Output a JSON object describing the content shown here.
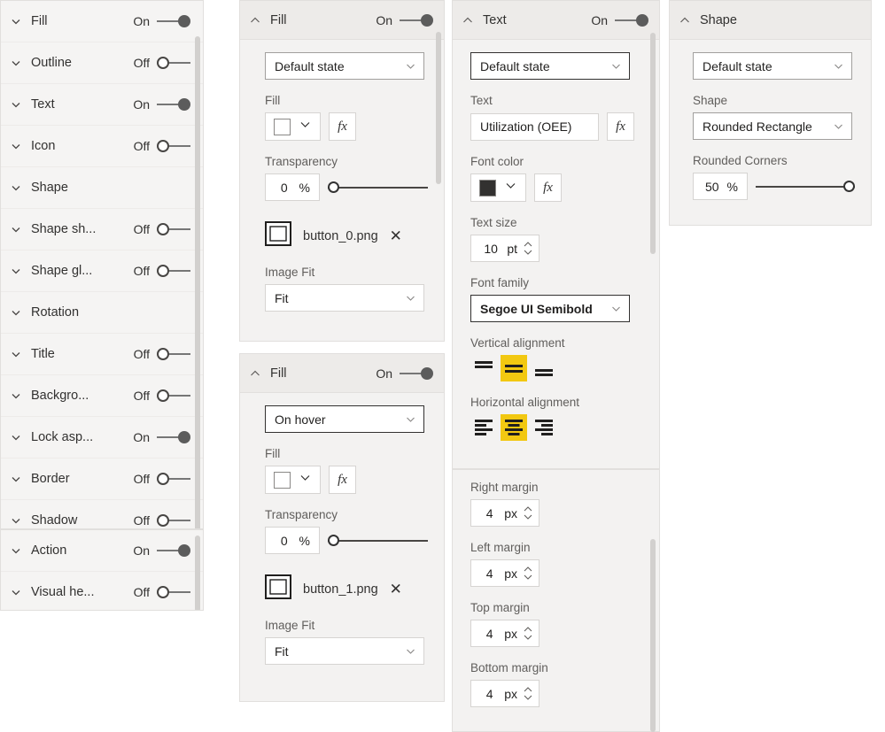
{
  "sidebar": {
    "top_items": [
      {
        "label": "Fill",
        "toggle_state": "On",
        "has_toggle": true
      },
      {
        "label": "Outline",
        "toggle_state": "Off",
        "has_toggle": true
      },
      {
        "label": "Text",
        "toggle_state": "On",
        "has_toggle": true
      },
      {
        "label": "Icon",
        "toggle_state": "Off",
        "has_toggle": true
      },
      {
        "label": "Shape",
        "toggle_state": "",
        "has_toggle": false
      },
      {
        "label": "Shape sh...",
        "toggle_state": "Off",
        "has_toggle": true
      },
      {
        "label": "Shape gl...",
        "toggle_state": "Off",
        "has_toggle": true
      },
      {
        "label": "Rotation",
        "toggle_state": "",
        "has_toggle": false
      },
      {
        "label": "Title",
        "toggle_state": "Off",
        "has_toggle": true
      },
      {
        "label": "Backgro...",
        "toggle_state": "Off",
        "has_toggle": true
      },
      {
        "label": "Lock asp...",
        "toggle_state": "On",
        "has_toggle": true
      },
      {
        "label": "Border",
        "toggle_state": "Off",
        "has_toggle": true
      },
      {
        "label": "Shadow",
        "toggle_state": "Off",
        "has_toggle": true
      }
    ],
    "bottom_items": [
      {
        "label": "Action",
        "toggle_state": "On",
        "has_toggle": true
      },
      {
        "label": "Visual he...",
        "toggle_state": "Off",
        "has_toggle": true
      }
    ]
  },
  "fill_default": {
    "header_title": "Fill",
    "header_toggle": "On",
    "state_dropdown": "Default state",
    "fill_label": "Fill",
    "fill_color": "#ffffff",
    "fx_label": "fx",
    "transparency_label": "Transparency",
    "transparency_value": "0",
    "transparency_unit": "%",
    "transparency_percent": 0,
    "image_name": "button_0.png",
    "remove_glyph": "✕",
    "image_fit_label": "Image Fit",
    "image_fit_value": "Fit"
  },
  "fill_hover": {
    "header_title": "Fill",
    "header_toggle": "On",
    "state_dropdown": "On hover",
    "fill_label": "Fill",
    "fill_color": "#ffffff",
    "fx_label": "fx",
    "transparency_label": "Transparency",
    "transparency_value": "0",
    "transparency_unit": "%",
    "transparency_percent": 0,
    "image_name": "button_1.png",
    "remove_glyph": "✕",
    "image_fit_label": "Image Fit",
    "image_fit_value": "Fit"
  },
  "text_panel": {
    "header_title": "Text",
    "header_toggle": "On",
    "state_dropdown": "Default state",
    "text_label": "Text",
    "text_value": "Utilization (OEE)",
    "fx_label": "fx",
    "font_color_label": "Font color",
    "font_color": "#323130",
    "text_size_label": "Text size",
    "text_size_value": "10",
    "text_size_unit": "pt",
    "font_family_label": "Font family",
    "font_family_value": "Segoe UI Semibold",
    "vertical_alignment_label": "Vertical alignment",
    "vertical_alignment_selected": 1,
    "horizontal_alignment_label": "Horizontal alignment",
    "horizontal_alignment_selected": 1,
    "highlight_color": "#f2c811",
    "margins": [
      {
        "label": "Right margin",
        "value": "4",
        "unit": "px"
      },
      {
        "label": "Left margin",
        "value": "4",
        "unit": "px"
      },
      {
        "label": "Top margin",
        "value": "4",
        "unit": "px"
      },
      {
        "label": "Bottom margin",
        "value": "4",
        "unit": "px"
      }
    ]
  },
  "shape_panel": {
    "header_title": "Shape",
    "state_dropdown": "Default state",
    "shape_label": "Shape",
    "shape_value": "Rounded Rectangle",
    "rounded_corners_label": "Rounded Corners",
    "rounded_corners_value": "50",
    "rounded_corners_unit": "%",
    "rounded_corners_percent": 100
  }
}
